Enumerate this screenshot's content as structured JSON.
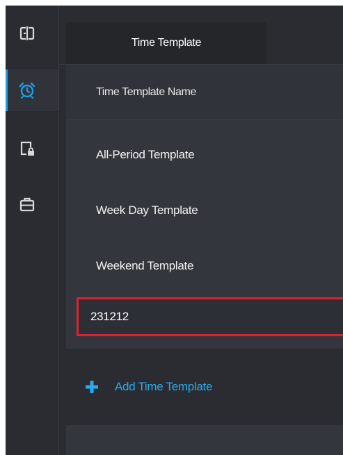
{
  "colors": {
    "accent": "#1fa0e5",
    "link": "#2aa9ec",
    "highlight_border": "#e0212d",
    "background": "#2a2c31"
  },
  "rail": {
    "items": [
      {
        "icon": "door-access-icon",
        "active": false
      },
      {
        "icon": "alarm-clock-icon",
        "active": true
      },
      {
        "icon": "device-lock-icon",
        "active": false
      },
      {
        "icon": "briefcase-icon",
        "active": false
      }
    ]
  },
  "tabs": [
    {
      "label": "Time Template"
    }
  ],
  "table": {
    "header": "Time Template Name",
    "rows": [
      {
        "name": "All-Period Template"
      },
      {
        "name": "Week Day Template"
      },
      {
        "name": "Weekend Template"
      }
    ],
    "editing_value": "231212"
  },
  "add_button": {
    "label": "Add Time Template"
  }
}
